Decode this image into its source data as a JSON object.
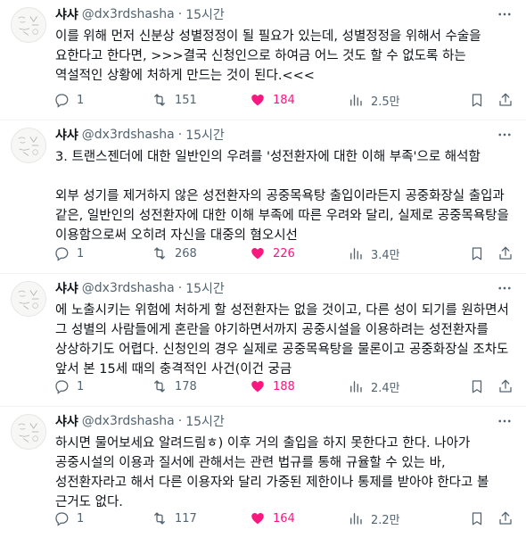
{
  "tweets": [
    {
      "name": "샤샤",
      "handle": "@dx3rdshasha",
      "dot": "·",
      "time": "15시간",
      "paragraphs": [
        "이를 위해 먼저 신분상 성별정정이 될 필요가 있는데, 성별정정을 위해서 수술을 요한다고 한다면, >>>결국 신청인으로 하여금 어느 것도 할 수 없도록 하는 역설적인 상황에 처하게 만드는 것이 된다.<<<"
      ],
      "retweets": "151",
      "likes": "184",
      "views": "2.5만"
    },
    {
      "name": "샤샤",
      "handle": "@dx3rdshasha",
      "dot": "·",
      "time": "15시간",
      "paragraphs": [
        "3. 트랜스젠더에 대한 일반인의 우려를 '성전환자에 대한 이해 부족'으로 해석함",
        "외부 성기를 제거하지 않은 성전환자의 공중목욕탕 출입이라든지 공중화장실 출입과 같은, 일반인의 성전환자에 대한 이해 부족에 따른 우려와 달리, 실제로 공중목욕탕을 이용함으로써 오히려 자신을 대중의 혐오시선"
      ],
      "retweets": "268",
      "likes": "226",
      "views": "3.4만"
    },
    {
      "name": "샤샤",
      "handle": "@dx3rdshasha",
      "dot": "·",
      "time": "15시간",
      "paragraphs": [
        "에 노출시키는 위험에 처하게 할 성전환자는 없을 것이고, 다른 성이 되기를 원하면서 그 성별의 사람들에게 혼란을 야기하면서까지 공중시설을 이용하려는 성전환자를 상상하기도 어렵다. 신청인의 경우 실제로 공중목욕탕을 물론이고 공중화장실 조차도 앞서 본 15세 때의 충격적인 사건(이건 궁금"
      ],
      "retweets": "178",
      "likes": "188",
      "views": "2.4만"
    },
    {
      "name": "샤샤",
      "handle": "@dx3rdshasha",
      "dot": "·",
      "time": "15시간",
      "paragraphs": [
        "하시면 물어보세요 알려드림ㅎ) 이후 거의 출입을 하지 못한다고 한다. 나아가 공중시설의 이용과 질서에 관해서는 관련 법규를 통해 규율할 수 있는 바, 성전환자라고 해서 다른 이용자와 달리 가중된 제한이나 통제를 받아야 한다고 볼 근거도 없다."
      ],
      "retweets": "117",
      "likes": "164",
      "views": "2.2만"
    }
  ],
  "replies": "1",
  "colors": {
    "like": "#f91880",
    "muted": "#536471",
    "text": "#0f1419"
  },
  "icons": [
    "more-icon",
    "reply-icon",
    "retweet-icon",
    "like-icon",
    "views-icon",
    "bookmark-icon",
    "share-icon"
  ]
}
